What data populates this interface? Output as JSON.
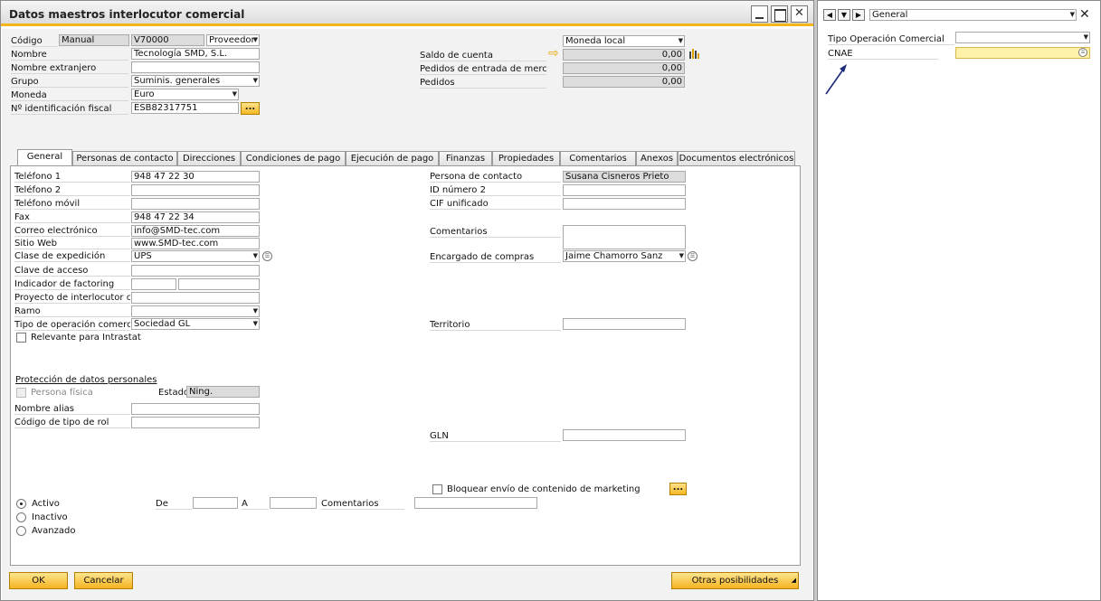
{
  "window": {
    "title": "Datos maestros interlocutor comercial"
  },
  "header": {
    "codigo_label": "Código",
    "codigo_series": "Manual",
    "codigo_value": "V70000",
    "codigo_type": "Proveedor",
    "nombre_label": "Nombre",
    "nombre_value": "Tecnología SMD, S.L.",
    "nombre_ext_label": "Nombre extranjero",
    "nombre_ext_value": "",
    "grupo_label": "Grupo",
    "grupo_value": "Suminis. generales",
    "moneda_label": "Moneda",
    "moneda_value": "Euro",
    "nif_label": "Nº identificación fiscal",
    "nif_value": "ESB82317751",
    "nif_button": "...",
    "currency_select": "Moneda local",
    "saldo_label": "Saldo de cuenta",
    "saldo_value": "0,00",
    "pedidos_entrada_label": "Pedidos de entrada de mercancías",
    "pedidos_entrada_value": "0,00",
    "pedidos_label": "Pedidos",
    "pedidos_value": "0,00"
  },
  "tabs": [
    {
      "label": "General"
    },
    {
      "label": "Personas de contacto"
    },
    {
      "label": "Direcciones"
    },
    {
      "label": "Condiciones de pago"
    },
    {
      "label": "Ejecución de pago"
    },
    {
      "label": "Finanzas"
    },
    {
      "label": "Propiedades"
    },
    {
      "label": "Comentarios"
    },
    {
      "label": "Anexos"
    },
    {
      "label": "Documentos electrónicos"
    }
  ],
  "general": {
    "telefono1_label": "Teléfono 1",
    "telefono1_value": "948 47 22 30",
    "telefono2_label": "Teléfono 2",
    "telefono2_value": "",
    "movil_label": "Teléfono móvil",
    "movil_value": "",
    "fax_label": "Fax",
    "fax_value": "948 47 22 34",
    "email_label": "Correo electrónico",
    "email_value": "info@SMD-tec.com",
    "web_label": "Sitio Web",
    "web_value": "www.SMD-tec.com",
    "expedicion_label": "Clase de expedición",
    "expedicion_value": "UPS",
    "clave_label": "Clave de acceso",
    "clave_value": "",
    "factoring_label": "Indicador de factoring",
    "proyecto_label": "Proyecto de interlocutor comercial",
    "ramo_label": "Ramo",
    "ramo_value": "",
    "tipo_op_label": "Tipo de operación comercial",
    "tipo_op_value": "Sociedad GL",
    "intrastat_label": "Relevante para Intrastat",
    "proteccion_label": "Protección de datos personales",
    "persona_fisica_label": "Persona física",
    "estado_label": "Estado",
    "estado_value": "Ning.",
    "alias_label": "Nombre alias",
    "rol_label": "Código de tipo de rol",
    "contacto_label": "Persona de contacto",
    "contacto_value": "Susana Cisneros Prieto",
    "id2_label": "ID número 2",
    "cif_label": "CIF unificado",
    "comentarios_label": "Comentarios",
    "encargado_label": "Encargado de compras",
    "encargado_value": "Jaime Chamorro Sanz",
    "territorio_label": "Territorio",
    "gln_label": "GLN",
    "bloquear_label": "Bloquear envío de contenido de marketing",
    "bloquear_button": "...",
    "activo_label": "Activo",
    "inactivo_label": "Inactivo",
    "avanzado_label": "Avanzado",
    "de_label": "De",
    "a_label": "A",
    "comentarios2_label": "Comentarios"
  },
  "footer": {
    "ok_label": "OK",
    "cancel_label": "Cancelar",
    "more_label": "Otras posibilidades"
  },
  "side_panel": {
    "category": "General",
    "tipo_op_label": "Tipo Operación Comercial",
    "tipo_op_value": "",
    "cnae_label": "CNAE",
    "cnae_value": ""
  },
  "colors": {
    "accent": "#f3b51a",
    "highlight_field": "#fff2a8",
    "readonly": "#dcdcdc"
  }
}
